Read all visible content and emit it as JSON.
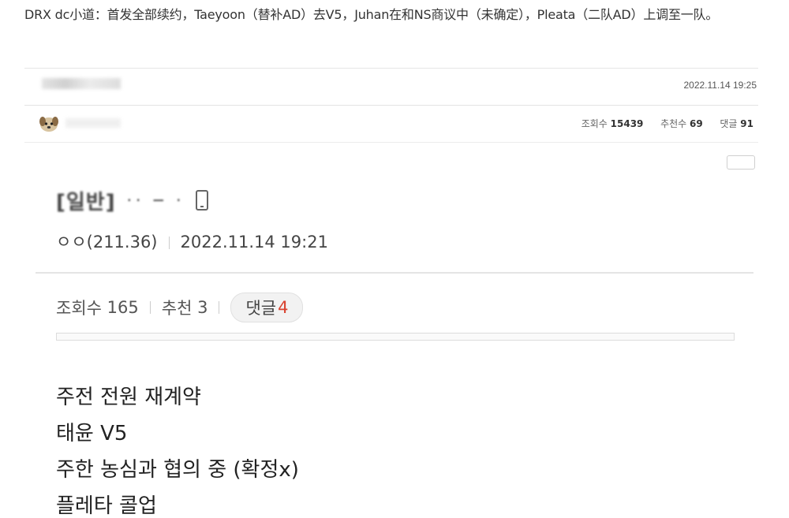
{
  "headline": "DRX dc小道：首发全部续约，Taeyoon（替补AD）去V5，Juhan在和NS商议中（未确定），Pleata（二队AD）上调至一队。",
  "top_bar": {
    "date": "2022.11.14 19:25"
  },
  "meta_bar": {
    "views_label": "조회수",
    "views_value": "15439",
    "recommend_label": "추천수",
    "recommend_value": "69",
    "comments_label": "댓글",
    "comments_value": "91"
  },
  "post": {
    "title_prefix": "[일반]",
    "author": "ㅇㅇ(211.36)",
    "date": "2022.11.14 19:21",
    "views_label": "조회수",
    "views_value": "165",
    "recommend_label": "추천",
    "recommend_value": "3",
    "comments_label": "댓글",
    "comments_value": "4",
    "body_lines": [
      "주전 전원 재계약",
      "태윤 V5",
      "주한 농심과 협의 중 (확정x)",
      "플레타 콜업"
    ]
  },
  "icons": {
    "avatar": "dog-avatar-icon",
    "mobile": "mobile-phone-icon"
  }
}
